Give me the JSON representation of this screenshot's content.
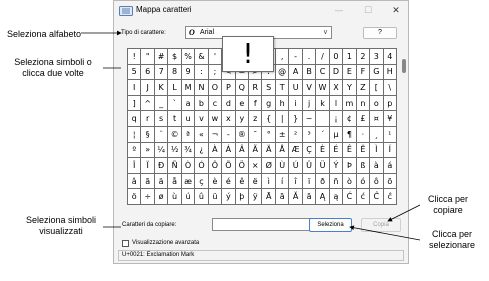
{
  "window": {
    "title": "Mappa caratteri",
    "minimize_glyph": "—",
    "maximize_glyph": "☐",
    "close_glyph": "✕"
  },
  "font_row": {
    "label": "Tipo di carattere:",
    "icon_glyph": "O",
    "value": "Arial",
    "caret": "∨",
    "help_label": "?"
  },
  "grid": {
    "rows": [
      [
        "!",
        "\"",
        "#",
        "$",
        "%",
        "&",
        "'",
        "(",
        ")",
        "*",
        "+",
        ",",
        "-",
        ".",
        "/",
        "0",
        "1",
        "2",
        "3",
        "4"
      ],
      [
        "5",
        "6",
        "7",
        "8",
        "9",
        ":",
        ";",
        "<",
        "=",
        ">",
        "?",
        "@",
        "A",
        "B",
        "C",
        "D",
        "E",
        "F",
        "G",
        "H"
      ],
      [
        "I",
        "J",
        "K",
        "L",
        "M",
        "N",
        "O",
        "P",
        "Q",
        "R",
        "S",
        "T",
        "U",
        "V",
        "W",
        "X",
        "Y",
        "Z",
        "[",
        "\\"
      ],
      [
        "]",
        "^",
        "_",
        "`",
        "a",
        "b",
        "c",
        "d",
        "e",
        "f",
        "g",
        "h",
        "i",
        "j",
        "k",
        "l",
        "m",
        "n",
        "o",
        "p"
      ],
      [
        "q",
        "r",
        "s",
        "t",
        "u",
        "v",
        "w",
        "x",
        "y",
        "z",
        "{",
        "|",
        "}",
        "~",
        " ",
        "¡",
        "¢",
        "£",
        "¤",
        "¥"
      ],
      [
        "¦",
        "§",
        "¨",
        "©",
        "ª",
        "«",
        "¬",
        "-",
        "®",
        "¯",
        "°",
        "±",
        "²",
        "³",
        "´",
        "µ",
        "¶",
        "·",
        "¸",
        "¹"
      ],
      [
        "º",
        "»",
        "¼",
        "½",
        "¾",
        "¿",
        "À",
        "Á",
        "Â",
        "Ã",
        "Ä",
        "Å",
        "Æ",
        "Ç",
        "È",
        "É",
        "Ê",
        "Ë",
        "Ì",
        "Í"
      ],
      [
        "Î",
        "Ï",
        "Ð",
        "Ñ",
        "Ò",
        "Ó",
        "Ô",
        "Õ",
        "Ö",
        "×",
        "Ø",
        "Ù",
        "Ú",
        "Û",
        "Ü",
        "Ý",
        "Þ",
        "ß",
        "à",
        "á"
      ],
      [
        "â",
        "ã",
        "ä",
        "å",
        "æ",
        "ç",
        "è",
        "é",
        "ê",
        "ë",
        "ì",
        "í",
        "î",
        "ï",
        "ð",
        "ñ",
        "ò",
        "ó",
        "ô",
        "õ"
      ],
      [
        "ö",
        "÷",
        "ø",
        "ù",
        "ú",
        "û",
        "ü",
        "ý",
        "þ",
        "ÿ",
        "Ā",
        "ā",
        "Ă",
        "ă",
        "Ą",
        "ą",
        "Ć",
        "ć",
        "Ĉ",
        "ĉ"
      ]
    ],
    "zoomed_char": "!"
  },
  "copy_row": {
    "label": "Caratteri da copiare:",
    "value": "",
    "select_label": "Seleziona",
    "copy_label": "Copia"
  },
  "advanced": {
    "label": "Visualizzazione avanzata",
    "checked": false
  },
  "status": {
    "text": "U+0021: Exclamation Mark"
  },
  "callouts": {
    "seleziona_alfabeto": "Seleziona alfabeto",
    "seleziona_simboli_line1": "Seleziona simboli o",
    "seleziona_simboli_line2": "clicca due volte",
    "visualizzati_line1": "Seleziona simboli",
    "visualizzati_line2": "visualizzati",
    "copiare_line1": "Clicca per",
    "copiare_line2": "copiare",
    "selezionare_line1": "Clicca per",
    "selezionare_line2": "selezionare"
  },
  "colors": {
    "dialog_bg": "#f3f3f3",
    "grid_line": "#6e6e6e",
    "accent_border": "#4a7fd0",
    "disabled_text": "#a0a0a0"
  }
}
